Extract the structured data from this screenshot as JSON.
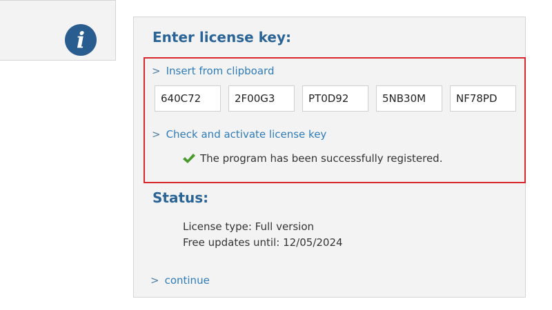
{
  "colors": {
    "heading": "#2a6496",
    "link": "#2e7bb8",
    "highlight_border": "#d9262c",
    "info_icon_bg": "#2a5d8f",
    "check_icon": "#4a9a2e"
  },
  "left_panel": {
    "icon": "info-icon",
    "icon_glyph": "i"
  },
  "license": {
    "heading": "Enter license key:",
    "insert_link": "Insert from clipboard",
    "keys": [
      "640C72",
      "2F00G3",
      "PT0D92",
      "5NB30M",
      "NF78PD"
    ],
    "check_link": "Check and activate license key",
    "success_icon": "check-icon",
    "success_message": "The program has been successfully registered."
  },
  "status": {
    "heading": "Status:",
    "license_type": "License type: Full version",
    "free_updates": "Free updates until: 12/05/2024"
  },
  "continue_link": "continue",
  "link_prefix": ">"
}
